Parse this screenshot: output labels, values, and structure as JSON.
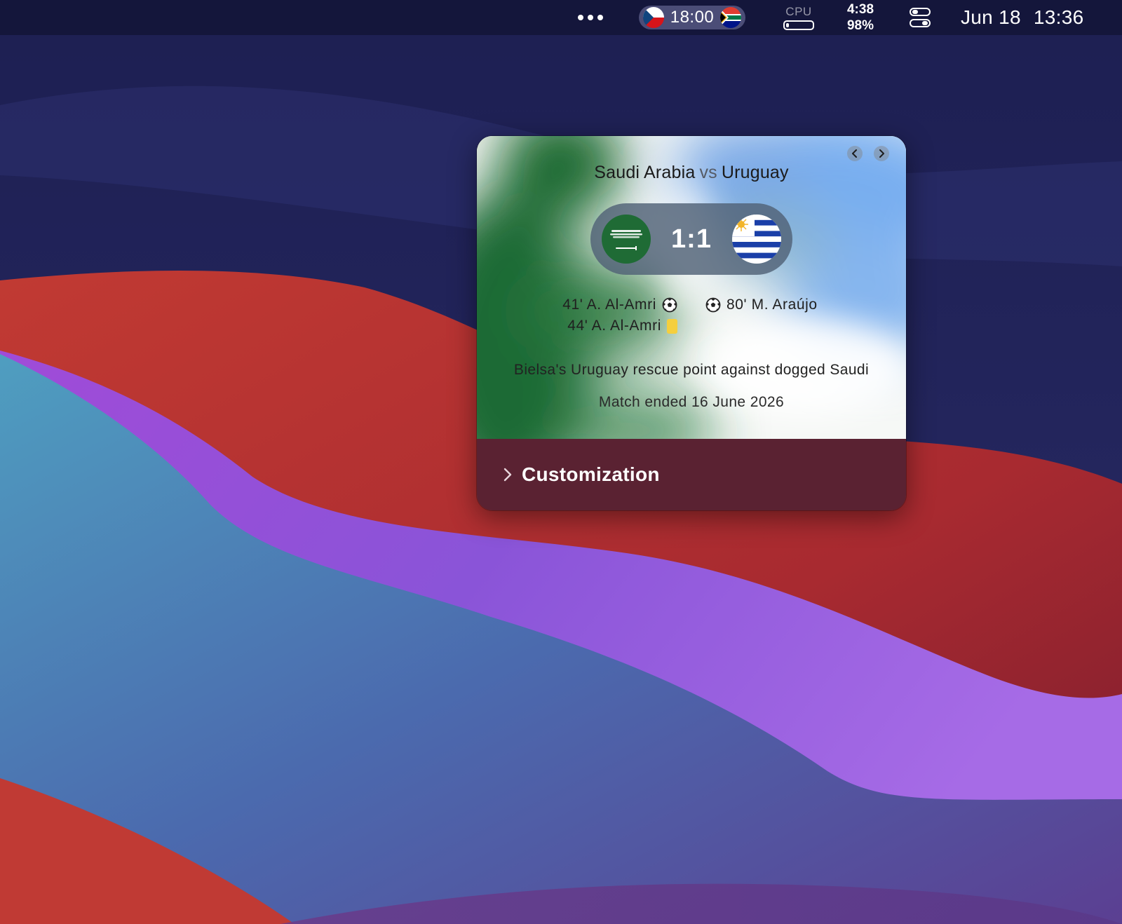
{
  "menubar": {
    "more_icon": "ellipsis-icon",
    "match_time": "18:00",
    "match_home_flag": "czech-flag-icon",
    "match_away_flag": "south-africa-flag-icon",
    "cpu_label": "CPU",
    "cpu_level_fraction": 0.1,
    "battery_time": "4:38",
    "battery_percent": "98%",
    "control_center_icon": "control-center-icon",
    "date": "Jun 18",
    "time": "13:36"
  },
  "widget": {
    "home_team": "Saudi Arabia",
    "vs_label": "vs",
    "away_team": "Uruguay",
    "score": "1:1",
    "home_flag_icon": "saudi-arabia-flag-icon",
    "away_flag_icon": "uruguay-flag-icon",
    "home_events": [
      {
        "text": "41' A. Al-Amri",
        "icon": "soccer-ball-icon"
      },
      {
        "text": "44' A. Al-Amri",
        "icon": "yellow-card-icon"
      }
    ],
    "away_events": [
      {
        "text": "80' M. Araújo",
        "icon": "soccer-ball-icon"
      }
    ],
    "headline": "Bielsa's Uruguay rescue point against dogged Saudi",
    "status": "Match ended 16 June 2026",
    "customization_label": "Customization",
    "colors": {
      "saudi_green": "#1f6b35",
      "uruguay_blue": "#78aef0",
      "bottom_bar": "#5a2232",
      "score_pill": "#506276",
      "yellow_card": "#f5cf3e"
    }
  }
}
